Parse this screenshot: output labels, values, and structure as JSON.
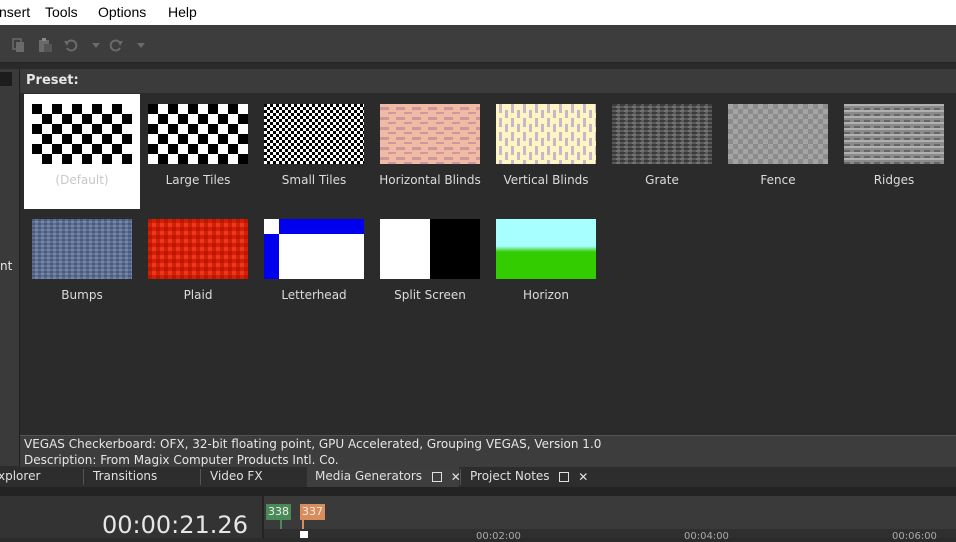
{
  "menu": {
    "items": [
      {
        "id": "insert",
        "label": "nsert"
      },
      {
        "id": "tools",
        "label": "Tools"
      },
      {
        "id": "options",
        "label": "Options"
      },
      {
        "id": "help",
        "label": "Help"
      }
    ]
  },
  "toolbar": {
    "icons": [
      "copy-icon",
      "paste-icon",
      "undo-icon",
      "undo-dropdown-icon",
      "redo-icon",
      "redo-dropdown-icon"
    ]
  },
  "left_panel": {
    "partial_text": "nt"
  },
  "preset": {
    "label": "Preset:",
    "items": [
      {
        "label": "(Default)",
        "selected": true
      },
      {
        "label": "Large Tiles"
      },
      {
        "label": "Small Tiles"
      },
      {
        "label": "Horizontal Blinds"
      },
      {
        "label": "Vertical Blinds"
      },
      {
        "label": "Grate"
      },
      {
        "label": "Fence"
      },
      {
        "label": "Ridges"
      },
      {
        "label": "Bumps"
      },
      {
        "label": "Plaid"
      },
      {
        "label": "Letterhead"
      },
      {
        "label": "Split Screen"
      },
      {
        "label": "Horizon"
      }
    ]
  },
  "info": {
    "line1": "VEGAS Checkerboard: OFX, 32-bit floating point, GPU Accelerated, Grouping VEGAS, Version 1.0",
    "line2": "Description: From Magix Computer Products Intl. Co."
  },
  "tabs": [
    {
      "label": "xplorer"
    },
    {
      "label": "Transitions"
    },
    {
      "label": "Video FX"
    },
    {
      "label": "Media Generators",
      "active": true
    },
    {
      "label": "Project Notes"
    }
  ],
  "tab_close_glyph": "✕",
  "timeline": {
    "timecode": "00:00:21.26",
    "markers": [
      {
        "label": "338",
        "color": "#4a8a56"
      },
      {
        "label": "337",
        "color": "#d98c5c"
      }
    ],
    "ruler": [
      "00:02:00",
      "00:04:00",
      "00:06:00"
    ]
  }
}
